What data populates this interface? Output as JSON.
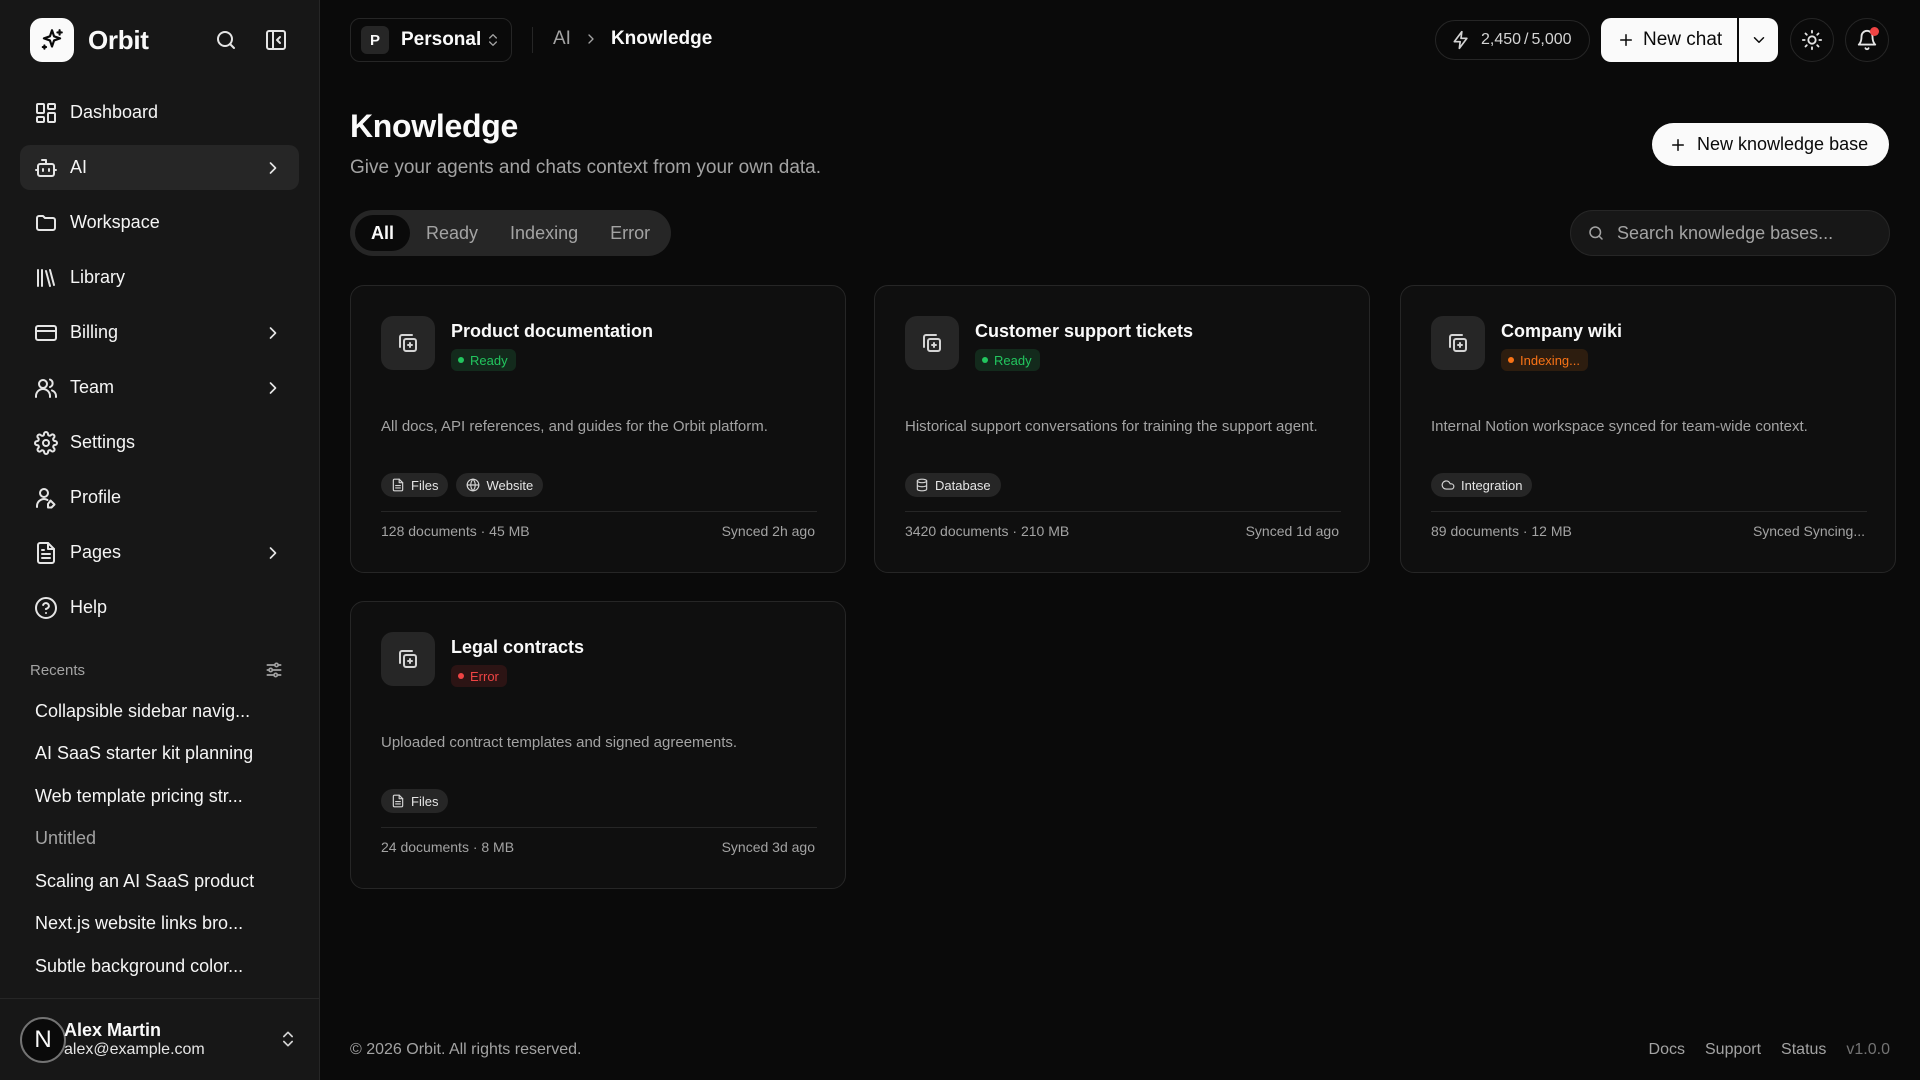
{
  "app": {
    "name": "Orbit"
  },
  "sidebar": {
    "nav": [
      {
        "label": "Dashboard",
        "icon": "layout-grid-icon"
      },
      {
        "label": "AI",
        "icon": "bot-icon",
        "active": true,
        "chevron": true
      },
      {
        "label": "Workspace",
        "icon": "folder-icon"
      },
      {
        "label": "Library",
        "icon": "library-icon"
      },
      {
        "label": "Billing",
        "icon": "credit-card-icon",
        "chevron": true
      },
      {
        "label": "Team",
        "icon": "users-icon",
        "chevron": true
      },
      {
        "label": "Settings",
        "icon": "gear-icon"
      },
      {
        "label": "Profile",
        "icon": "user-icon"
      },
      {
        "label": "Pages",
        "icon": "file-icon",
        "chevron": true
      },
      {
        "label": "Help",
        "icon": "help-circle-icon"
      }
    ],
    "recents_title": "Recents",
    "recents": [
      "Collapsible sidebar navig...",
      "AI SaaS starter kit planning",
      "Web template pricing str...",
      "Untitled",
      "Scaling an AI SaaS product",
      "Next.js website links bro...",
      "Subtle background color..."
    ],
    "user": {
      "initial": "N",
      "name": "Alex Martin",
      "email": "alex@example.com"
    }
  },
  "topbar": {
    "workspace": {
      "badge": "P",
      "name": "Personal"
    },
    "breadcrumb": {
      "parent": "AI",
      "current": "Knowledge"
    },
    "credits": {
      "used": "2,450",
      "total": "5,000"
    },
    "new_chat_label": "New chat"
  },
  "page": {
    "title": "Knowledge",
    "subtitle": "Give your agents and chats context from your own data.",
    "new_button": "New knowledge base",
    "tabs": [
      "All",
      "Ready",
      "Indexing",
      "Error"
    ],
    "active_tab": "All",
    "search_placeholder": "Search knowledge bases..."
  },
  "cards": [
    {
      "title": "Product documentation",
      "status": "Ready",
      "status_kind": "ready",
      "description": "All docs, API references, and guides for the Orbit platform.",
      "sources": [
        {
          "label": "Files",
          "icon": "file-text-icon"
        },
        {
          "label": "Website",
          "icon": "globe-icon"
        }
      ],
      "meta": "128 documents · 45 MB",
      "synced": "Synced 2h ago"
    },
    {
      "title": "Customer support tickets",
      "status": "Ready",
      "status_kind": "ready",
      "description": "Historical support conversations for training the support agent.",
      "sources": [
        {
          "label": "Database",
          "icon": "database-icon"
        }
      ],
      "meta": "3420 documents · 210 MB",
      "synced": "Synced 1d ago"
    },
    {
      "title": "Company wiki",
      "status": "Indexing...",
      "status_kind": "indexing",
      "description": "Internal Notion workspace synced for team-wide context.",
      "sources": [
        {
          "label": "Integration",
          "icon": "cloud-icon"
        }
      ],
      "meta": "89 documents · 12 MB",
      "synced": "Synced Syncing..."
    },
    {
      "title": "Legal contracts",
      "status": "Error",
      "status_kind": "error",
      "description": "Uploaded contract templates and signed agreements.",
      "sources": [
        {
          "label": "Files",
          "icon": "file-text-icon"
        }
      ],
      "meta": "24 documents · 8 MB",
      "synced": "Synced 3d ago"
    }
  ],
  "footer": {
    "copyright": "© 2026 Orbit. All rights reserved.",
    "links": [
      "Docs",
      "Support",
      "Status"
    ],
    "version": "v1.0.0"
  },
  "colors": {
    "background": "#0a0a0a",
    "sidebar": "#171717",
    "ready": "#22c55e",
    "indexing": "#f97316",
    "error": "#ef4444"
  }
}
